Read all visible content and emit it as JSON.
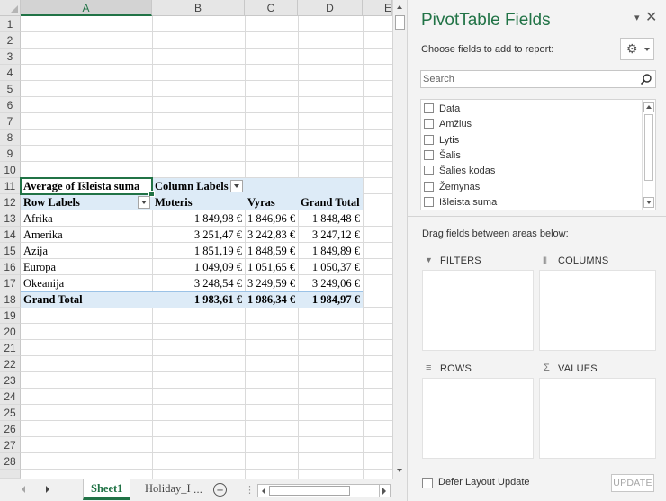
{
  "sheet": {
    "columns": [
      "A",
      "B",
      "C",
      "D",
      "E"
    ],
    "active_column": "A",
    "row_numbers": [
      "1",
      "2",
      "3",
      "4",
      "5",
      "6",
      "7",
      "8",
      "9",
      "10",
      "11",
      "12",
      "13",
      "14",
      "15",
      "16",
      "17",
      "18",
      "19",
      "20",
      "21",
      "22",
      "23",
      "24",
      "25",
      "26",
      "27",
      "28"
    ],
    "pivot": {
      "value_header": "Average of Išleista suma",
      "column_labels": "Column Labels",
      "row_labels": "Row Labels",
      "col_headers": [
        "Moteris",
        "Vyras",
        "Grand Total"
      ],
      "rows": [
        {
          "label": "Afrika",
          "values": [
            "1 849,98 €",
            "1 846,96 €",
            "1 848,48 €"
          ]
        },
        {
          "label": "Amerika",
          "values": [
            "3 251,47 €",
            "3 242,83 €",
            "3 247,12 €"
          ]
        },
        {
          "label": "Azija",
          "values": [
            "1 851,19 €",
            "1 848,59 €",
            "1 849,89 €"
          ]
        },
        {
          "label": "Europa",
          "values": [
            "1 049,09 €",
            "1 051,65 €",
            "1 050,37 €"
          ]
        },
        {
          "label": "Okeanija",
          "values": [
            "3 248,54 €",
            "3 249,59 €",
            "3 249,06 €"
          ]
        }
      ],
      "grand_total": {
        "label": "Grand Total",
        "values": [
          "1 983,61 €",
          "1 986,34 €",
          "1 984,97 €"
        ]
      }
    },
    "tabs": {
      "active": "Sheet1",
      "other": "Holiday_I",
      "more": "...",
      "add": "+"
    }
  },
  "pane": {
    "title": "PivotTable Fields",
    "dropdown_glyph": "▾",
    "close_glyph": "✕",
    "choose_label": "Choose fields to add to report:",
    "gear_glyph": "⚙",
    "search_placeholder": "Search",
    "fields": [
      "Data",
      "Amžius",
      "Lytis",
      "Šalis",
      "Šalies kodas",
      "Žemynas",
      "Išleista suma"
    ],
    "drag_label": "Drag fields between areas below:",
    "areas": {
      "filters": "FILTERS",
      "columns": "COLUMNS",
      "rows": "ROWS",
      "values": "VALUES"
    },
    "area_icons": {
      "filters": "▼",
      "columns": "|||",
      "rows": "≡",
      "values": "Σ"
    },
    "defer_label": "Defer Layout Update",
    "update_label": "UPDATE"
  }
}
